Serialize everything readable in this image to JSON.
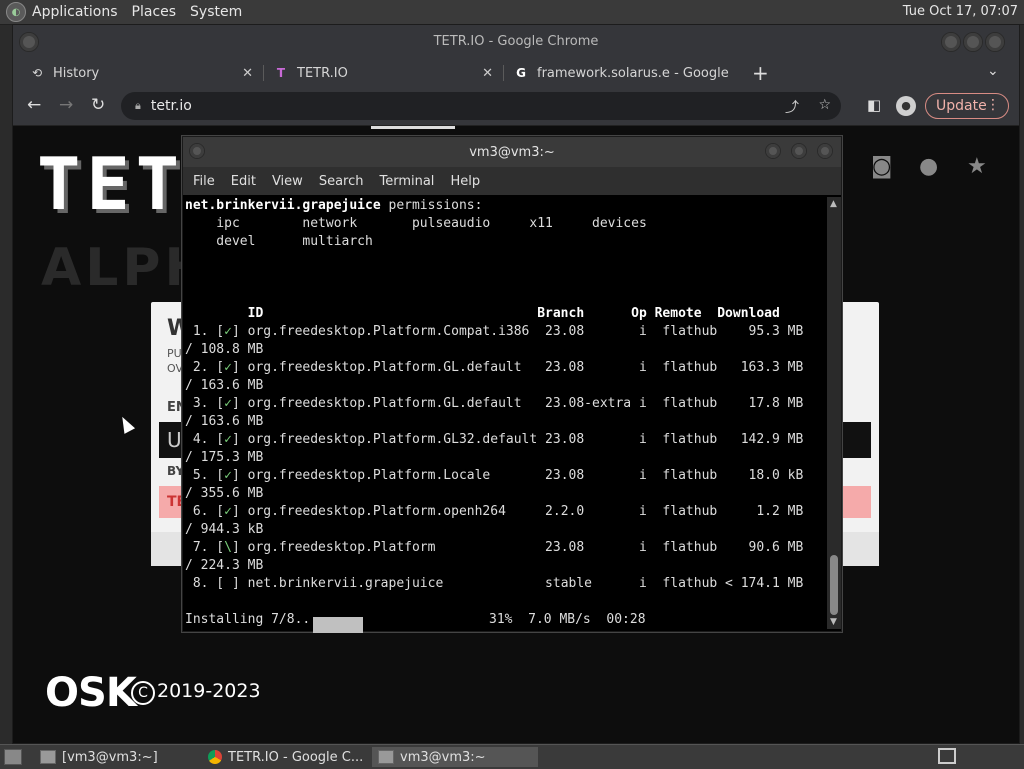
{
  "top_panel": {
    "menus": [
      "Applications",
      "Places",
      "System"
    ],
    "clock": "Tue Oct 17, 07:07"
  },
  "chrome": {
    "title": "TETR.IO - Google Chrome",
    "tabs": [
      {
        "label": "History",
        "icon": "history-icon"
      },
      {
        "label": "TETR.IO",
        "icon": "tetrio-icon"
      },
      {
        "label": "framework.solarus.e - Google",
        "icon": "google-icon"
      }
    ],
    "url": "tetr.io",
    "update_label": "Update"
  },
  "page": {
    "logo_text": "TETR",
    "alpha_text": "ALPH",
    "card": {
      "w": "W",
      "pu": "PU\nOV",
      "en": "EN",
      "u": "U",
      "by": "BY",
      "te": "TE"
    },
    "osk": "OSK",
    "copyright": "2019-2023"
  },
  "terminal": {
    "title": "vm3@vm3:~",
    "menu": [
      "File",
      "Edit",
      "View",
      "Search",
      "Terminal",
      "Help"
    ],
    "app_name": "net.brinkervii.grapejuice",
    "permissions_label": " permissions:",
    "perm_line1": "    ipc        network       pulseaudio     x11     devices",
    "perm_line2": "    devel      multiarch",
    "header": "        ID                                   Branch      Op Remote  Download",
    "rows": [
      {
        "pre": " 1. [",
        "mark": "✓",
        "post": "] org.freedesktop.Platform.Compat.i386  23.08       i  flathub    95.3 MB",
        "cont": "/ 108.8 MB"
      },
      {
        "pre": " 2. [",
        "mark": "✓",
        "post": "] org.freedesktop.Platform.GL.default   23.08       i  flathub   163.3 MB",
        "cont": "/ 163.6 MB"
      },
      {
        "pre": " 3. [",
        "mark": "✓",
        "post": "] org.freedesktop.Platform.GL.default   23.08-extra i  flathub    17.8 MB",
        "cont": "/ 163.6 MB"
      },
      {
        "pre": " 4. [",
        "mark": "✓",
        "post": "] org.freedesktop.Platform.GL32.default 23.08       i  flathub   142.9 MB",
        "cont": "/ 175.3 MB"
      },
      {
        "pre": " 5. [",
        "mark": "✓",
        "post": "] org.freedesktop.Platform.Locale       23.08       i  flathub    18.0 kB",
        "cont": "/ 355.6 MB"
      },
      {
        "pre": " 6. [",
        "mark": "✓",
        "post": "] org.freedesktop.Platform.openh264     2.2.0       i  flathub     1.2 MB",
        "cont": "/ 944.3 kB"
      },
      {
        "pre": " 7. [",
        "mark": "\\",
        "post": "] org.freedesktop.Platform              23.08       i  flathub    90.6 MB",
        "cont": "/ 224.3 MB"
      },
      {
        "pre": " 8. [",
        "mark": " ",
        "post": "] net.brinkervii.grapejuice             stable      i  flathub < 174.1 MB",
        "cont": ""
      }
    ],
    "status_prefix": "Installing 7/8...",
    "status_suffix": "31%  7.0 MB/s  00:28",
    "progress_fraction": 0.31
  },
  "taskbar": {
    "items": [
      {
        "label": "[vm3@vm3:~]",
        "icon": "terminal-icon"
      },
      {
        "label": "TETR.IO - Google C...",
        "icon": "chrome-icon"
      },
      {
        "label": "vm3@vm3:~",
        "icon": "terminal-icon"
      }
    ]
  }
}
